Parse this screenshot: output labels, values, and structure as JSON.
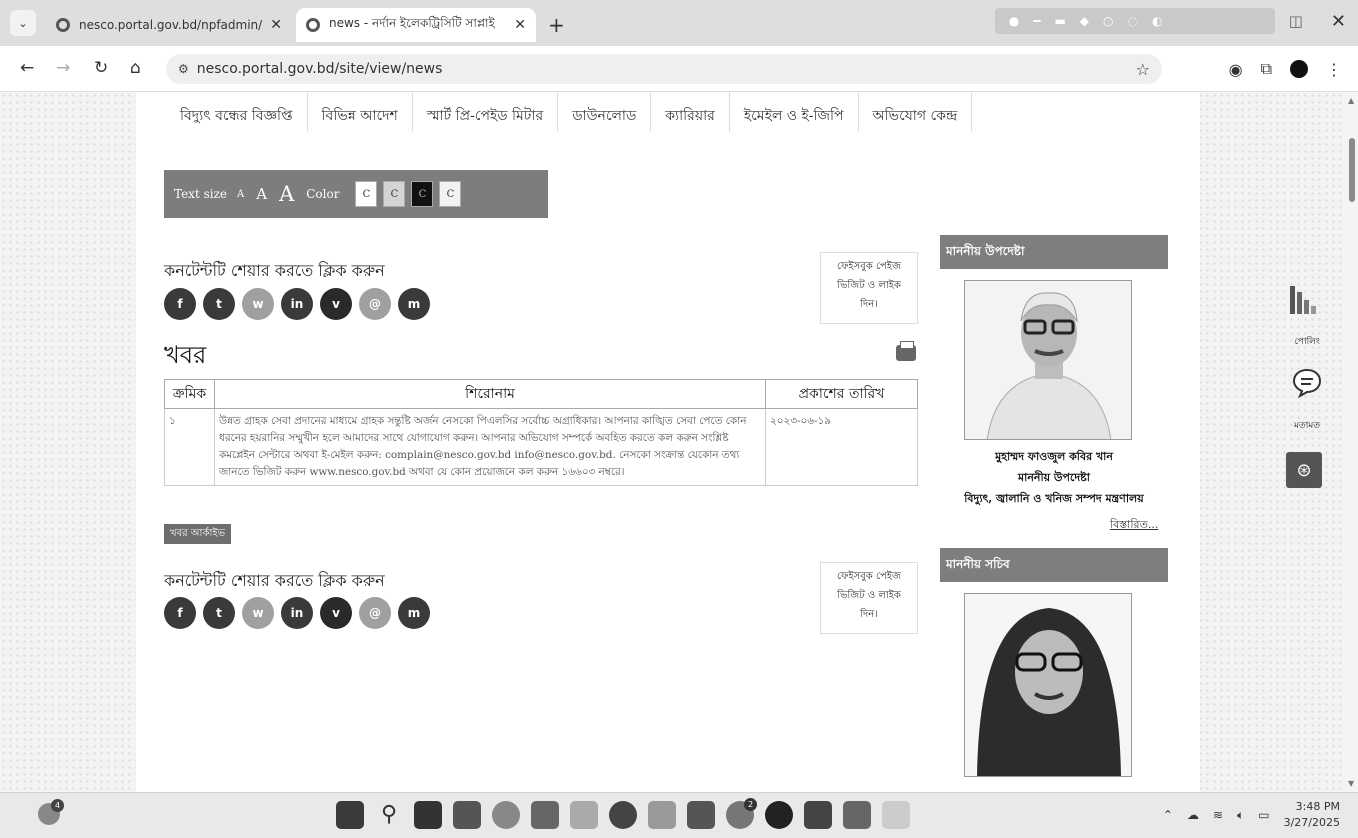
{
  "browser": {
    "tabs": [
      {
        "title": "nesco.portal.gov.bd/npfadmin/",
        "active": false
      },
      {
        "title": "news - নর্দান ইলেকট্রিসিটি সাপ্লাই",
        "active": true
      }
    ],
    "address": "nesco.portal.gov.bd/site/view/news"
  },
  "menu": [
    "বিদ্যুৎ বন্ধের বিজ্ঞপ্তি",
    "বিভিন্ন আদেশ",
    "স্মার্ট প্রি-পেইড মিটার",
    "ডাউনলোড",
    "ক্যারিয়ার",
    "ইমেইল ও ই-জিপি",
    "অভিযোগ কেন্দ্র"
  ],
  "accessibility": {
    "text_size_label": "Text size",
    "sizes": [
      "A",
      "A",
      "A"
    ],
    "color_label": "Color",
    "swatch_label": "C"
  },
  "share": {
    "title": "কনটেন্টটি শেয়ার করতে ক্লিক করুন",
    "buttons": [
      "f",
      "t",
      "w",
      "in",
      "v",
      "@",
      "m"
    ],
    "facebook_box": [
      "ফেইসবুক পেইজ",
      "ভিজিট ও লাইক",
      "দিন।"
    ]
  },
  "page_title": "খবর",
  "news_table": {
    "headers": [
      "ক্রমিক",
      "শিরোনাম",
      "প্রকাশের তারিখ"
    ],
    "rows": [
      {
        "serial": "১",
        "title": "উন্নত গ্রাহক সেবা প্রদানের মাধ্যমে গ্রাহক সন্তুষ্টি অর্জন নেসকো পিএলসির সর্বোচ্চ অগ্রাধিকার। আপনার কাঙ্খিত সেবা পেতে কোন ধরনের হয়রানির সম্মুখীন হলে আমাদের সাথে যোগাযোগ করুন। আপনার অভিযোগ সম্পর্কে অবহিত করতে কল করুন সংশ্লিষ্ট কমপ্লেইন সেন্টারে অথবা ই-মেইল করুন: complain@nesco.gov.bd info@nesco.gov.bd. নেসকো সংক্রান্ত যেকোন তথ্য জানতে ভিজিট করুন www.nesco.gov.bd অথবা যে কোন প্রয়োজনে কল করুন ১৬৬০৩ নম্বরে।",
        "date": "২০২৩-০৬-১৯"
      }
    ]
  },
  "archive_label": "খবর আর্কাইভ",
  "sidebar": {
    "advisor_heading": "মাননীয় উপদেষ্টা",
    "advisor_name": "মুহাম্মদ ফাওজুল কবির খান",
    "advisor_role": "মাননীয় উপদেষ্টা",
    "advisor_ministry": "বিদ্যুৎ, জ্বালানি ও খনিজ সম্পদ মন্ত্রণালয়",
    "more_link": "বিস্তারিত...",
    "secretary_heading": "মাননীয় সচিব"
  },
  "right_widgets": {
    "polling": "পোলিং",
    "opinion": "মতামত"
  },
  "taskbar": {
    "widget_badge": "4",
    "time": "3:48 PM",
    "date": "3/27/2025",
    "whatsapp_badge": "2"
  },
  "colors": {
    "header_gray": "#7e7e7e",
    "accessibility_bar": "#7d7d7d",
    "share_dark": "#3a3a3a",
    "share_light": "#9a9a9a"
  }
}
